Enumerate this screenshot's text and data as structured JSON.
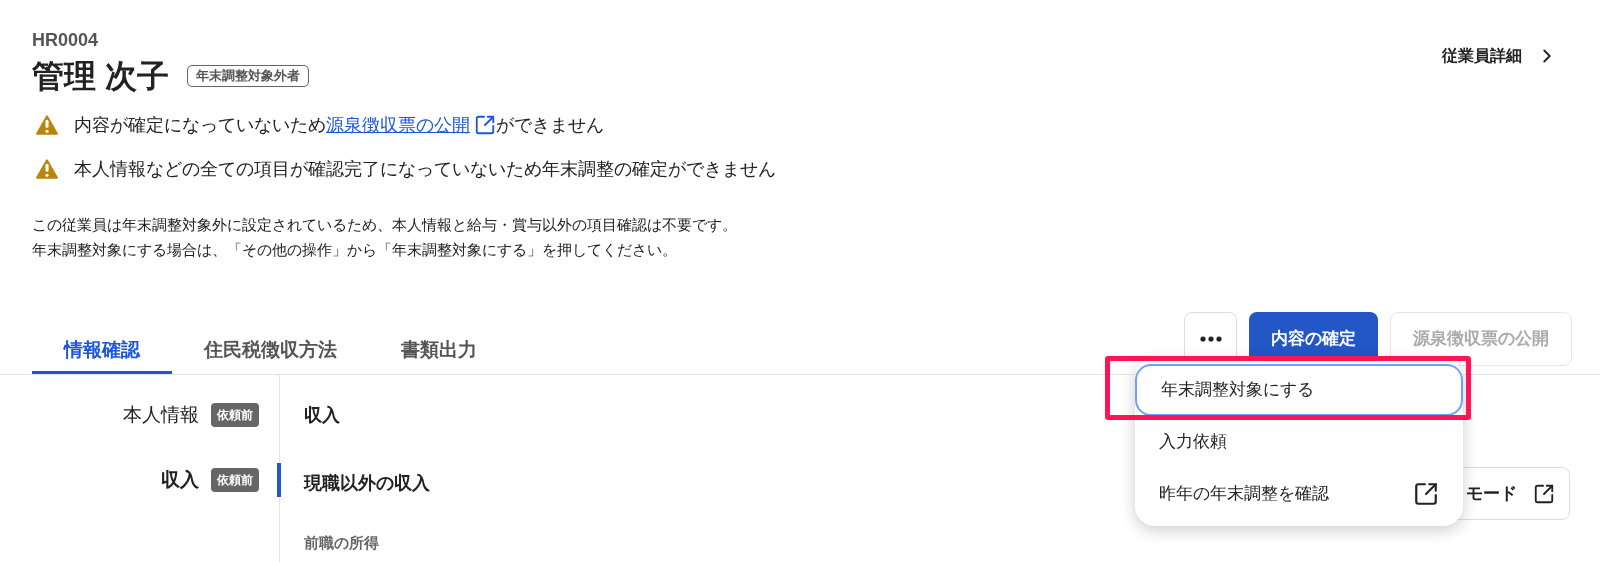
{
  "employee": {
    "code": "HR0004",
    "name": "管理 次子",
    "badge": "年末調整対象外者"
  },
  "detail_link": {
    "label": "従業員詳細"
  },
  "warnings": [
    {
      "before": "内容が確定になっていないため",
      "link": "源泉徴収票の公開",
      "after": "ができません"
    },
    {
      "before": "本人情報などの全ての項目が確認完了になっていないため年末調整の確定ができません"
    }
  ],
  "notice": [
    "この従業員は年末調整対象外に設定されているため、本人情報と給与・賞与以外の項目確認は不要です。",
    "年末調整対象にする場合は、「その他の操作」から「年末調整対象にする」を押してください。"
  ],
  "tabs": [
    {
      "label": "情報確認",
      "selected": true
    },
    {
      "label": "住民税徴収方法",
      "selected": false
    },
    {
      "label": "書類出力",
      "selected": false
    }
  ],
  "actions": {
    "confirm_button": {
      "label": "内容の確定",
      "disabled": false
    },
    "publish_button": {
      "label": "源泉徴収票の公開",
      "disabled": true
    }
  },
  "menu": {
    "items": [
      {
        "label": "年末調整対象にする",
        "highlighted": true,
        "external": false
      },
      {
        "label": "入力依頼",
        "highlighted": false,
        "external": false
      },
      {
        "label": "昨年の年末調整を確認",
        "highlighted": false,
        "external": true
      }
    ]
  },
  "mode_button": {
    "label": "モード"
  },
  "sidebar": {
    "items": [
      {
        "label": "本人情報",
        "badge": "依頼前",
        "selected": false
      },
      {
        "label": "収入",
        "badge": "依頼前",
        "selected": true
      }
    ]
  },
  "content": {
    "title": "収入",
    "section": "現職以外の収入",
    "subsection": "前職の所得"
  }
}
